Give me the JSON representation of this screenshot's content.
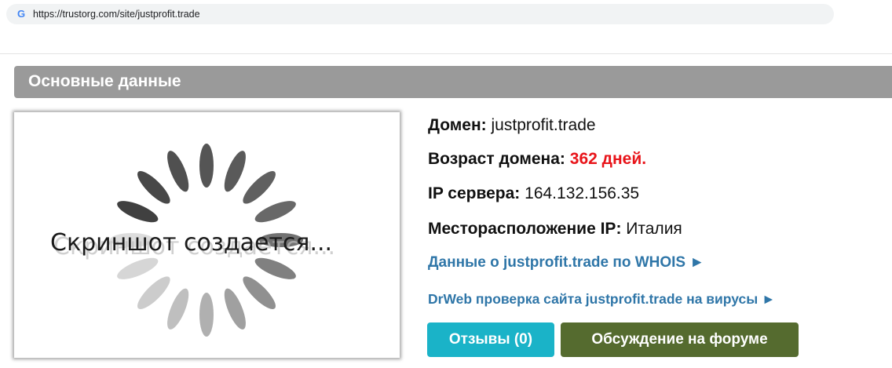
{
  "browser": {
    "url": "https://trustorg.com/site/justprofit.trade",
    "favicon_icon": "google-g-icon"
  },
  "section": {
    "title": "Основные данные"
  },
  "screenshot": {
    "placeholder_text": "Скриншот создается..."
  },
  "info": {
    "domain_label": "Домен:",
    "domain_value": "justprofit.trade",
    "age_label": "Возраст домена:",
    "age_value": "362 дней.",
    "ip_label": "IP сервера:",
    "ip_value": "164.132.156.35",
    "location_label": "Месторасположение IP:",
    "location_value": "Италия",
    "age_color": "#e8141a"
  },
  "links": {
    "whois": "Данные о justprofit.trade по WHOIS ►",
    "drweb": "DrWeb проверка сайта justprofit.trade на вирусы ►"
  },
  "buttons": {
    "reviews": "Отзывы (0)",
    "forum": "Обсуждение на форуме"
  },
  "colors": {
    "header_bg": "#9a9a9a",
    "link": "#2f76a8",
    "reviews_button": "#1ab3c8",
    "forum_button": "#556b2f"
  }
}
